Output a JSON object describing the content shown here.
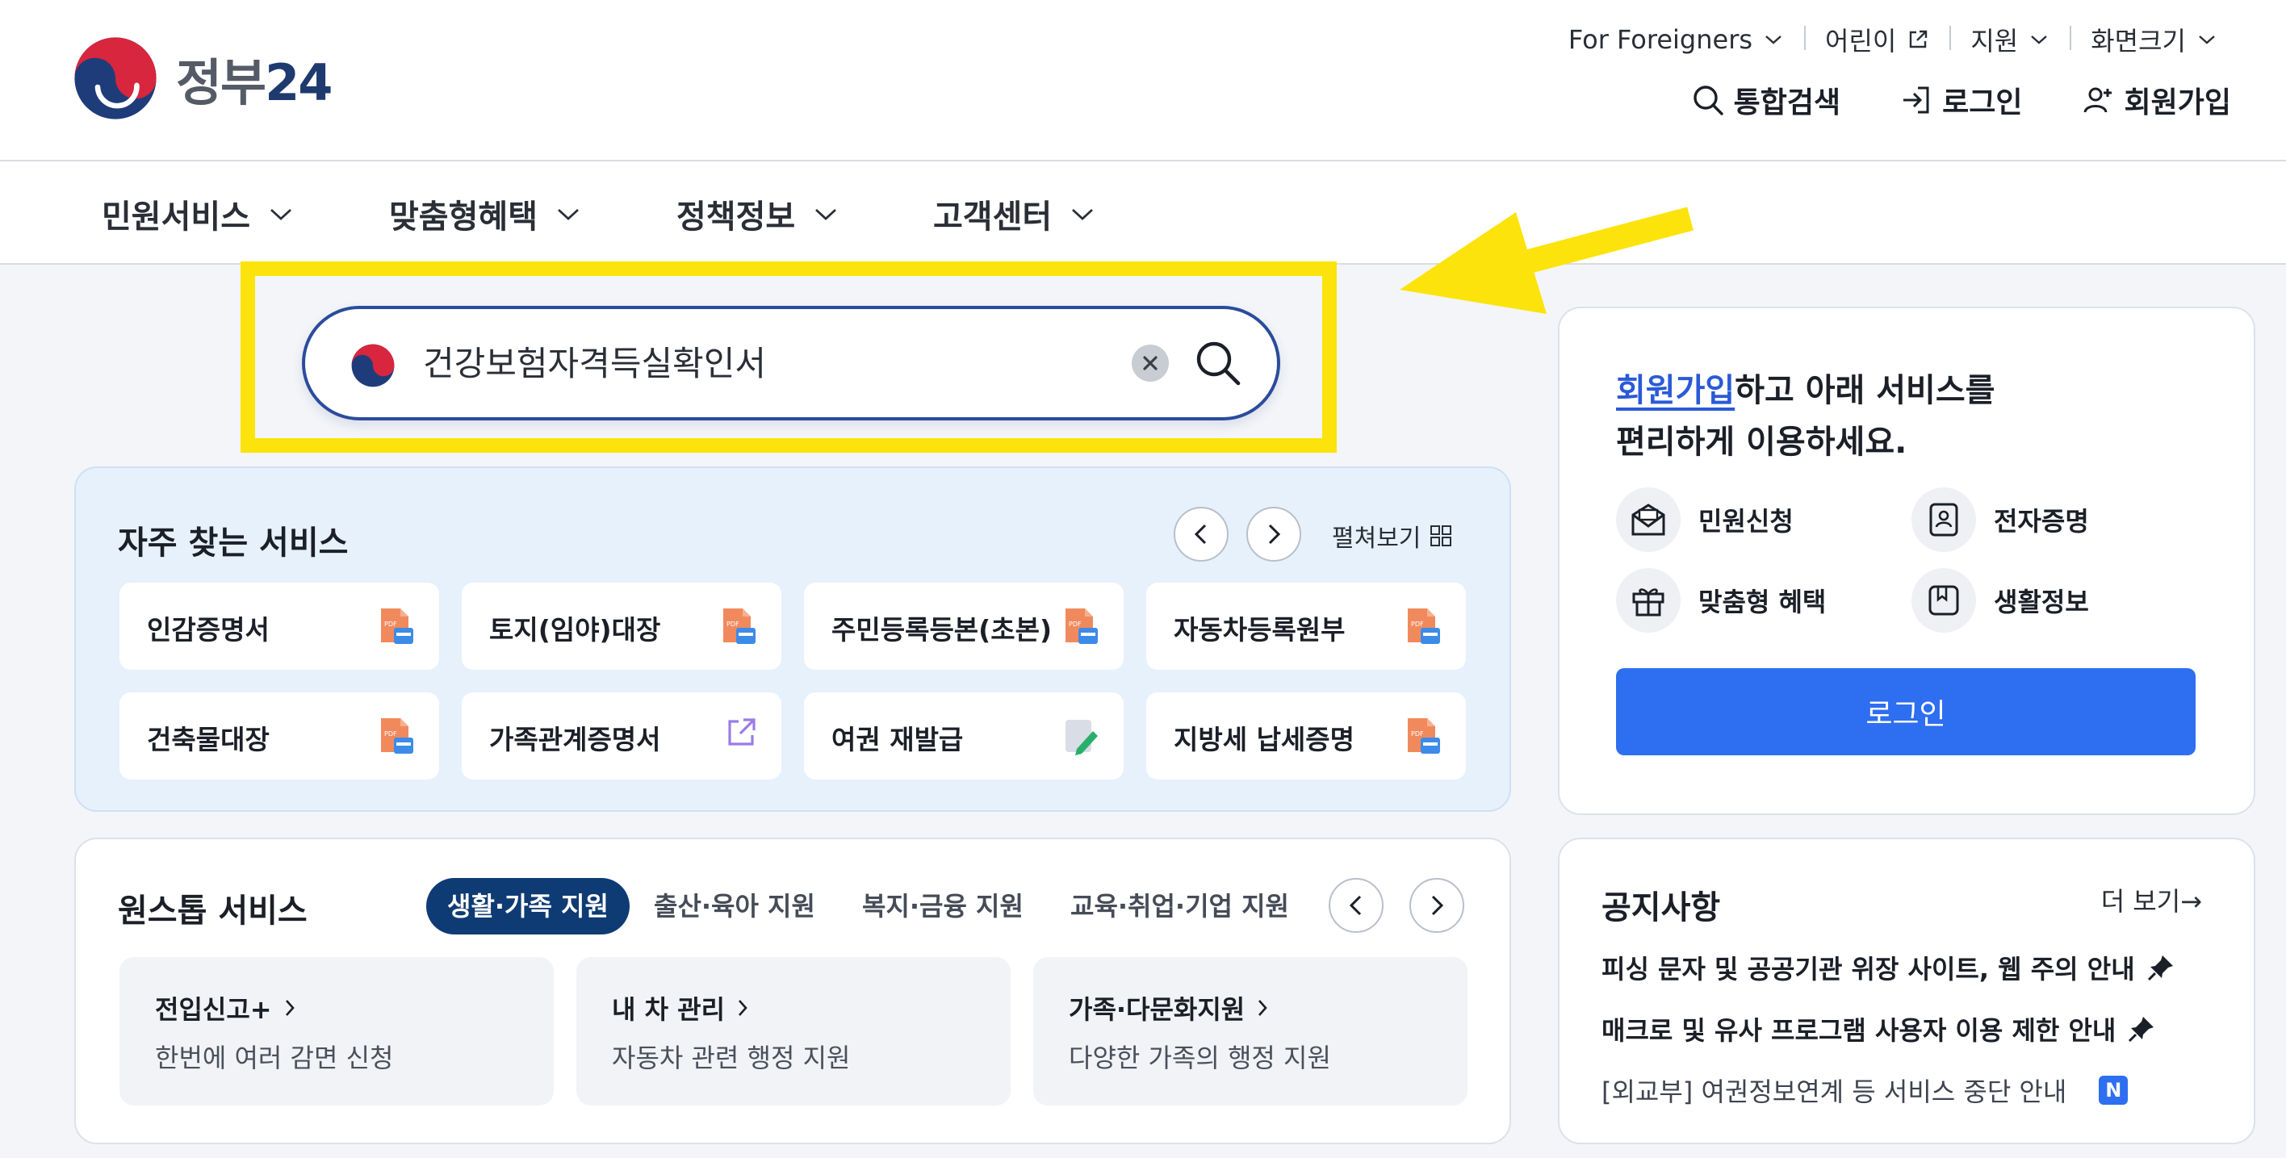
{
  "logo": {
    "text_kr": "정부",
    "text_num": "24"
  },
  "util_links": [
    {
      "label": "For Foreigners"
    },
    {
      "label": "어린이"
    },
    {
      "label": "지원"
    },
    {
      "label": "화면크기"
    }
  ],
  "top_actions": {
    "search": "통합검색",
    "login": "로그인",
    "signup": "회원가입"
  },
  "gnb": [
    "민원서비스",
    "맞춤형혜택",
    "정책정보",
    "고객센터"
  ],
  "search": {
    "value": "건강보험자격득실확인서"
  },
  "frequent": {
    "title": "자주 찾는 서비스",
    "expand_label": "펼쳐보기",
    "items": [
      {
        "label": "인감증명서",
        "icon": "pdf-doc-icon"
      },
      {
        "label": "토지(임야)대장",
        "icon": "pdf-doc-icon"
      },
      {
        "label": "주민등록등본(초본)",
        "icon": "pdf-doc-icon"
      },
      {
        "label": "자동차등록원부",
        "icon": "pdf-doc-icon"
      },
      {
        "label": "건축물대장",
        "icon": "pdf-doc-icon"
      },
      {
        "label": "가족관계증명서",
        "icon": "external-link-icon"
      },
      {
        "label": "여권 재발급",
        "icon": "edit-doc-icon"
      },
      {
        "label": "지방세 납세증명",
        "icon": "pdf-doc-icon"
      }
    ]
  },
  "onestop": {
    "title": "원스톱 서비스",
    "tabs": [
      "생활·가족 지원",
      "출산·육아 지원",
      "복지·금융 지원",
      "교육·취업·기업 지원"
    ],
    "cards": [
      {
        "title": "전입신고+",
        "desc": "한번에 여러 감면 신청"
      },
      {
        "title": "내 차 관리",
        "desc": "자동차 관련 행정 지원"
      },
      {
        "title": "가족·다문화지원",
        "desc": "다양한 가족의 행정 지원"
      }
    ]
  },
  "login_card": {
    "link_text": "회원가입",
    "line1_rest": "하고 아래 서비스를",
    "line2": "편리하게 이용하세요.",
    "quick": [
      "민원신청",
      "전자증명",
      "맞춤형 혜택",
      "생활정보"
    ],
    "button": "로그인"
  },
  "notices": {
    "title": "공지사항",
    "more": "더 보기→",
    "items": [
      "피싱 문자 및 공공기관 위장 사이트, 웹 주의 안내",
      "매크로 및 유사 프로그램 사용자 이용 제한 안내",
      "[외교부] 여권정보연계 등 서비스 중단 안내"
    ],
    "new_badge": "N"
  },
  "colors": {
    "highlight": "#fce30b",
    "primary": "#2e6ef0",
    "navy": "#0f3b74"
  }
}
